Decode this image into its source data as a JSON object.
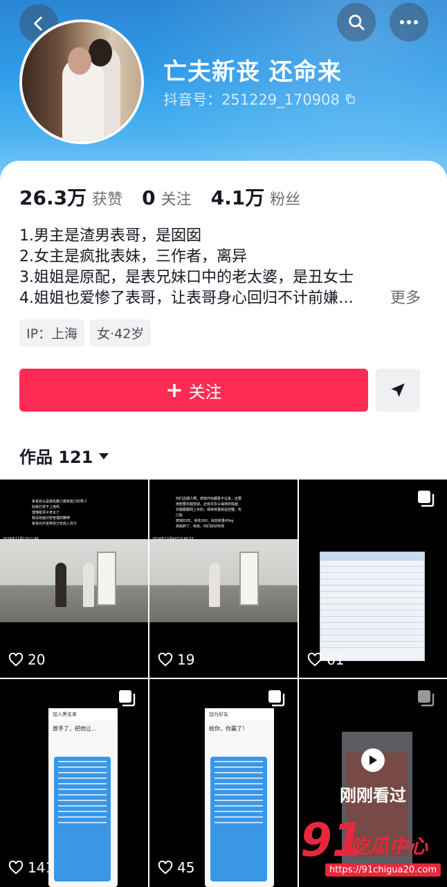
{
  "profile": {
    "nickname": "亡夫新丧 还命来",
    "douyin_id": "抖音号：251229_170908",
    "stats": [
      {
        "value": "26.3万",
        "label": "获赞"
      },
      {
        "value": "0",
        "label": "关注"
      },
      {
        "value": "4.1万",
        "label": "粉丝"
      }
    ],
    "bio": [
      "1.男主是渣男表哥，是囡囡",
      "2.女主是疯批表妹，三作者，离异",
      "3.姐姐是原配，是表兄妹口中的老太婆，是丑女士",
      "4.姐姐也爱惨了表哥，让表哥身心回归不计前嫌…"
    ],
    "more_label": "更多",
    "tags": [
      "IP：上海",
      "女·42岁"
    ],
    "follow_label": "关注",
    "follow_plus": "+",
    "works_tab": "作品 121"
  },
  "colors": {
    "accent": "#fe2c55",
    "banner": "#2f9be8"
  },
  "grid": {
    "tiles": [
      {
        "likes": "20",
        "multi": false,
        "caption": [
          "家哥自认是最有魅力最有能力的男人",
          "别来打扰不上他吗",
          "澳辣挺漂子老太了",
          "我没有面对管管理的精神",
          "家哥对外宣称自己年收入百万"
        ],
        "stamp": "2024年11月1日21:46"
      },
      {
        "likes": "19",
        "multi": false,
        "caption": [
          "你们这期人啊，表妹开始都看不过来，还要",
          "用粉要衣服挂掉，还有衬衣么保持的体面",
          "衣服都都网上买的，保持体重就是控糖，吃",
          "口饭",
          "表妹83年，身高160，目前体重45kg",
          "高级胖了，哈哈，你们好好吃吧"
        ],
        "stamp": "2024年12月4日19:45:53"
      },
      {
        "likes": "61",
        "multi": true
      },
      {
        "likes": "141",
        "multi": true,
        "chat_header": "加入黑名单",
        "chat_line": "放手了，把他让..."
      },
      {
        "likes": "45",
        "multi": true,
        "chat_header": "加为好友",
        "chat_line": "给你，你赢了！"
      },
      {
        "likes": "",
        "multi": true,
        "overlay": "刚刚看过"
      }
    ]
  },
  "watermark": {
    "logo": "91",
    "text": "吃瓜中心",
    "url": "https://91chigua20.com"
  }
}
